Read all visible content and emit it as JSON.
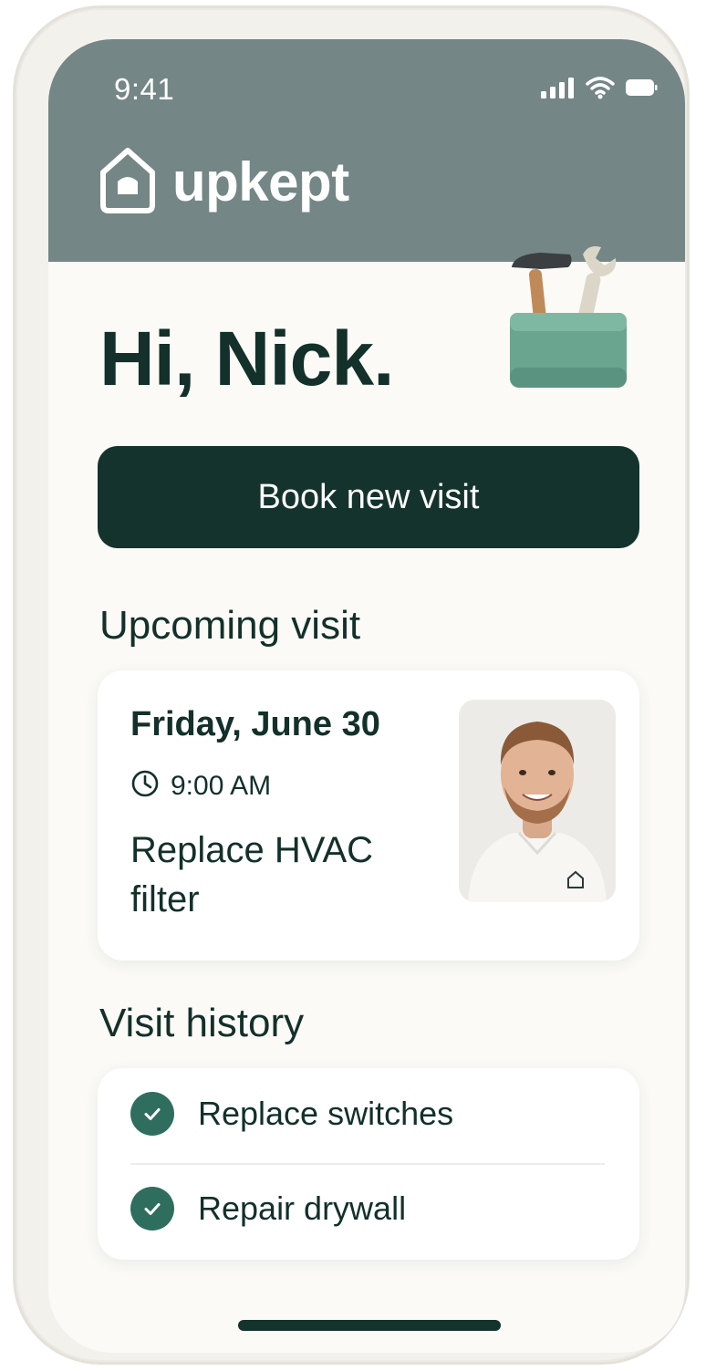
{
  "status_bar": {
    "time": "9:41",
    "icons": [
      "signal-icon",
      "wifi-icon",
      "battery-icon"
    ]
  },
  "app": {
    "name": "upkept",
    "logo_icon": "house-icon"
  },
  "greeting": "Hi, Nick.",
  "illustration": "toolbox-icon",
  "primary_action": {
    "label": "Book new visit"
  },
  "upcoming": {
    "section_title": "Upcoming visit",
    "date": "Friday, June 30",
    "time": "9:00 AM",
    "time_icon": "clock-icon",
    "task": "Replace HVAC filter",
    "technician_photo": "technician-avatar"
  },
  "history": {
    "section_title": "Visit history",
    "items": [
      {
        "label": "Replace switches",
        "status_icon": "check-icon"
      },
      {
        "label": "Repair drywall",
        "status_icon": "check-icon"
      }
    ]
  },
  "colors": {
    "header": "#748686",
    "primary": "#14332c",
    "accent": "#2f6e5f",
    "background": "#fbfaf7",
    "text": "#13302a"
  }
}
